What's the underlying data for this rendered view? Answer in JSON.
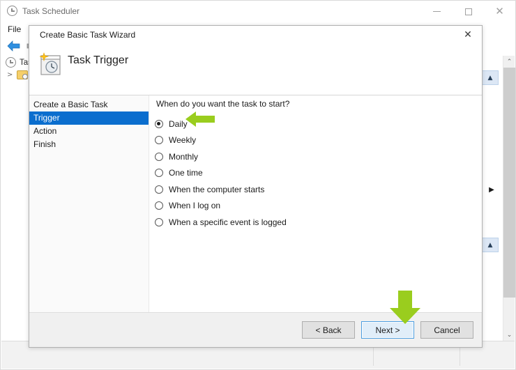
{
  "app_window": {
    "title": "Task Scheduler",
    "title_icon": "clock-icon",
    "window_controls": {
      "minimize": "minimize-icon",
      "maximize": "maximize-icon",
      "close": "close-icon"
    },
    "menubar": {
      "items": [
        "File"
      ]
    },
    "toolbar": {
      "back_icon": "back-arrow-icon",
      "forward_icon": "forward-arrow-icon"
    },
    "tree": {
      "root_label": "Task",
      "child_expander": ">",
      "child_icon": "folder-clock-icon"
    },
    "scrollbar": {
      "up_arrow": "⌃",
      "down_arrow": "⌄",
      "hscroll_left_arrow": "◀"
    },
    "panel_buttons": {
      "collapse_top": "▲",
      "collapse_mid": "▲",
      "expand_right": "▶"
    }
  },
  "wizard": {
    "title": "Create Basic Task Wizard",
    "close_label": "✕",
    "heading": "Task Trigger",
    "heading_icon": "task-trigger-calendar-clock-icon",
    "steps": [
      {
        "label": "Create a Basic Task",
        "active": false
      },
      {
        "label": "Trigger",
        "active": true
      },
      {
        "label": "Action",
        "active": false
      },
      {
        "label": "Finish",
        "active": false
      }
    ],
    "prompt": "When do you want the task to start?",
    "options": [
      {
        "label": "Daily",
        "selected": true
      },
      {
        "label": "Weekly",
        "selected": false
      },
      {
        "label": "Monthly",
        "selected": false
      },
      {
        "label": "One time",
        "selected": false
      },
      {
        "label": "When the computer starts",
        "selected": false
      },
      {
        "label": "When I log on",
        "selected": false
      },
      {
        "label": "When a specific event is logged",
        "selected": false
      }
    ],
    "buttons": {
      "back": "< Back",
      "next": "Next >",
      "cancel": "Cancel"
    }
  },
  "annotations": {
    "arrow_color": "#9ACD1E",
    "left_arrow_target": "Daily",
    "down_arrow_target": "Next >"
  }
}
